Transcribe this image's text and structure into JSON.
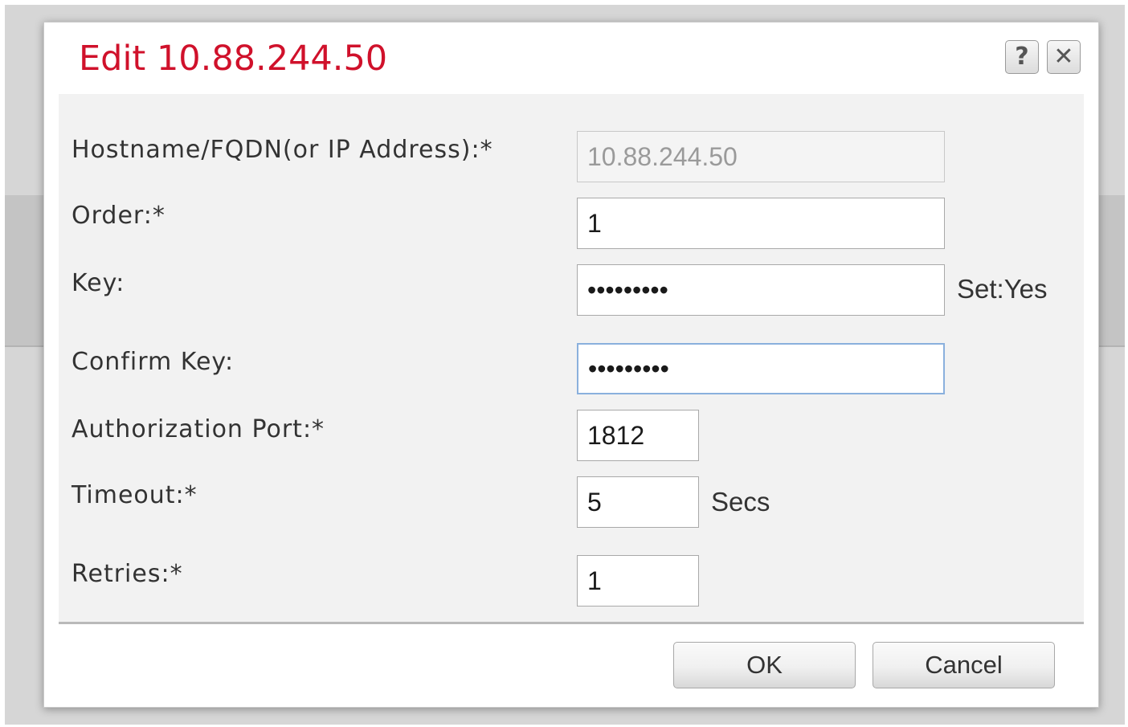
{
  "dialog": {
    "title": "Edit 10.88.244.50",
    "help_icon": "?",
    "close_icon": "✕"
  },
  "form": {
    "hostname": {
      "label": "Hostname/FQDN(or IP Address):*",
      "value": "10.88.244.50"
    },
    "order": {
      "label": "Order:*",
      "value": "1"
    },
    "key": {
      "label": "Key:",
      "value": "•••••••••",
      "status": "Set:Yes"
    },
    "confirm_key": {
      "label": "Confirm Key:",
      "value": "•••••••••"
    },
    "auth_port": {
      "label": "Authorization Port:*",
      "value": "1812"
    },
    "timeout": {
      "label": "Timeout:*",
      "value": "5",
      "unit": "Secs"
    },
    "retries": {
      "label": "Retries:*",
      "value": "1"
    }
  },
  "buttons": {
    "ok": "OK",
    "cancel": "Cancel"
  },
  "colors": {
    "title": "#d0112b",
    "focus_border": "#8ab0dd"
  }
}
